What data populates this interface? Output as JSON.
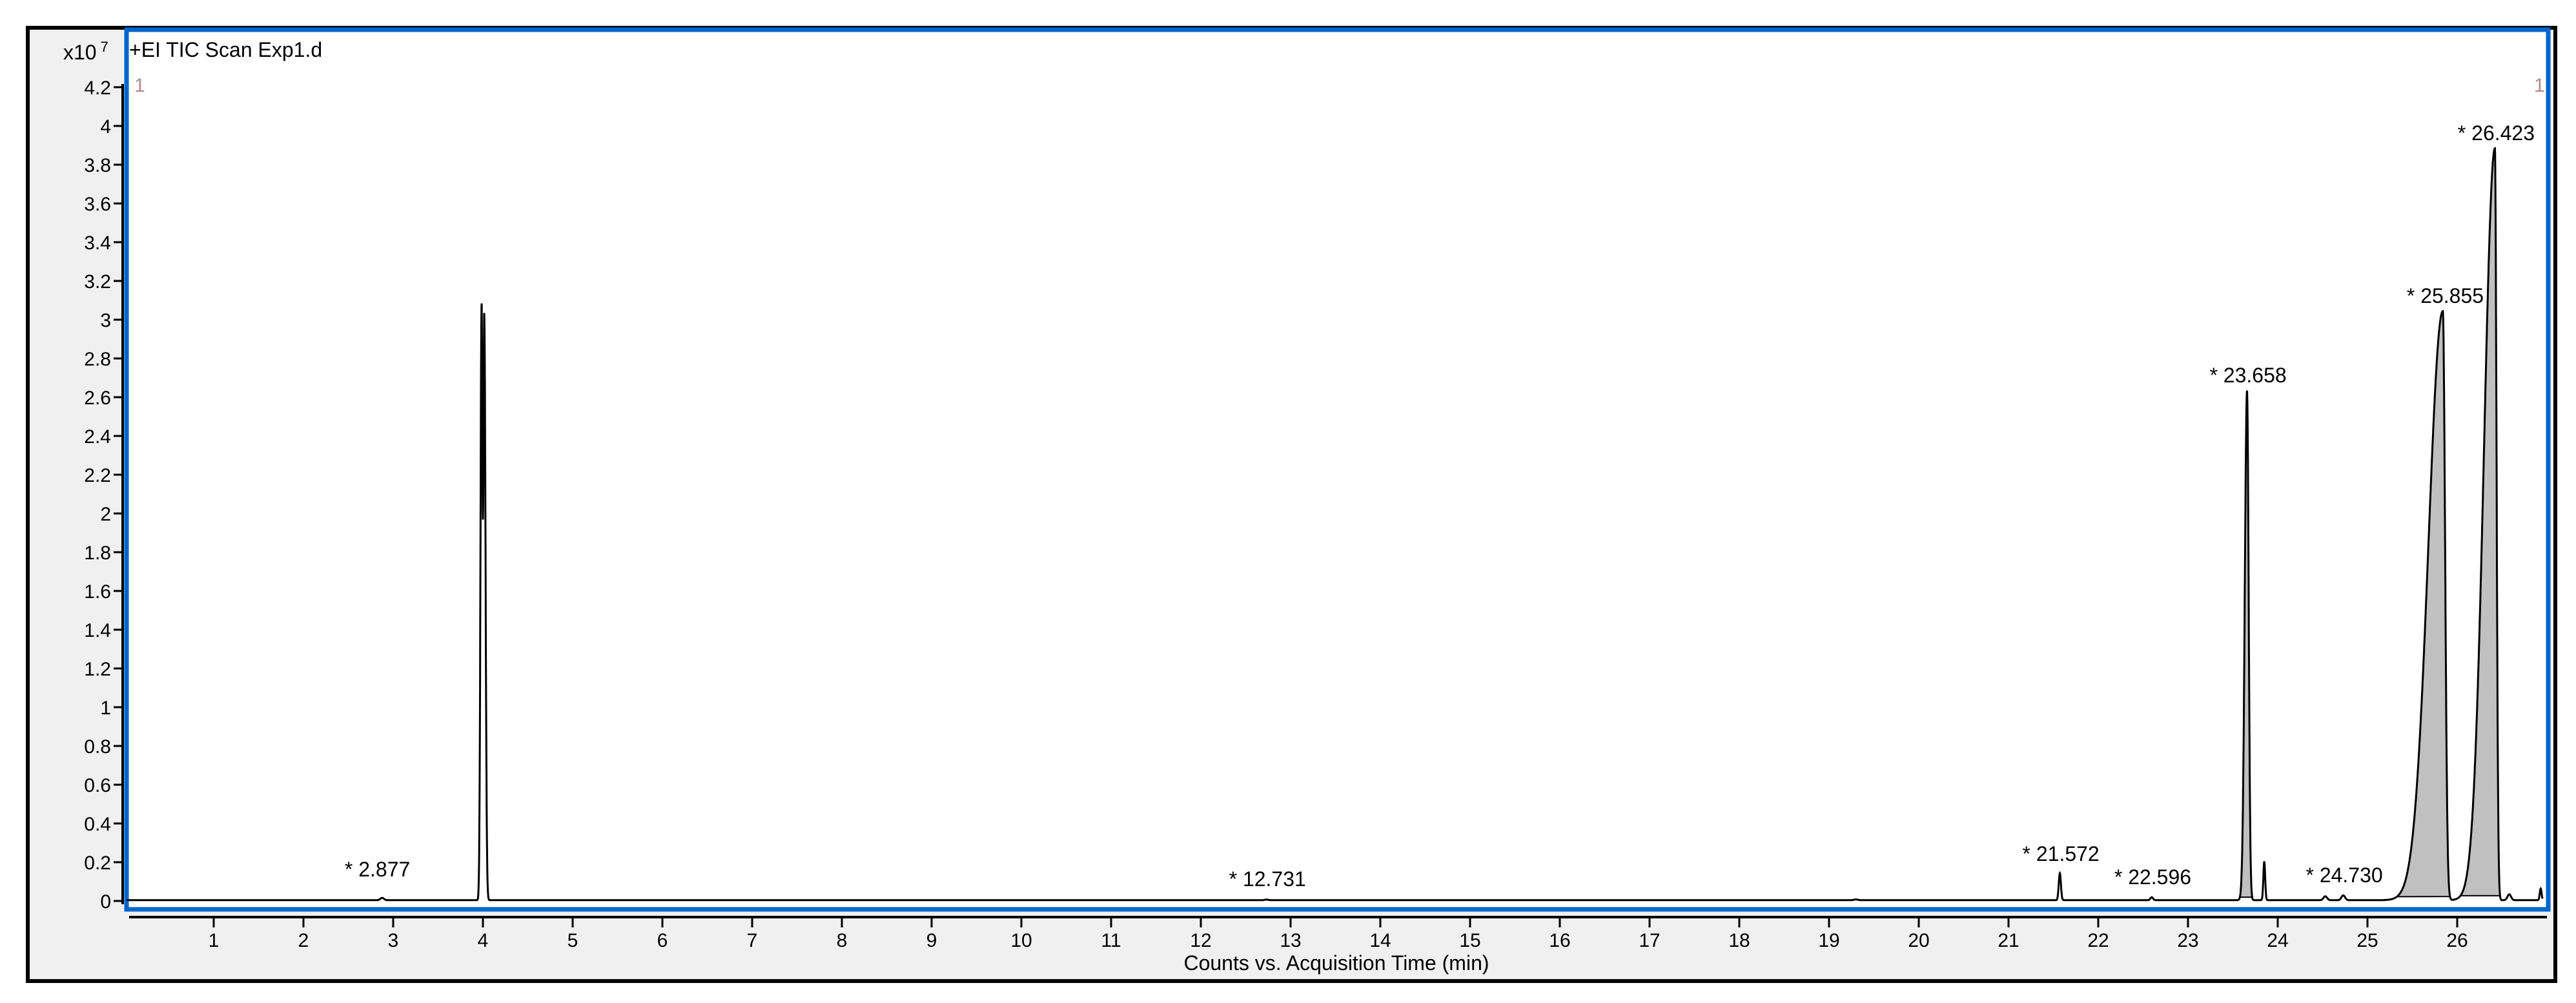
{
  "chart_data": {
    "type": "line",
    "title": "+EI TIC Scan Exp1.d",
    "y_multiplier": "x10",
    "y_multiplier_exp": "7",
    "xlabel": "Counts vs. Acquisition Time (min)",
    "ylabel": "",
    "xlim": [
      0,
      26.9
    ],
    "ylim": [
      0,
      4.3
    ],
    "x_ticks": [
      "1",
      "2",
      "3",
      "4",
      "5",
      "6",
      "7",
      "8",
      "9",
      "10",
      "11",
      "12",
      "13",
      "14",
      "15",
      "16",
      "17",
      "18",
      "19",
      "20",
      "21",
      "22",
      "23",
      "24",
      "25",
      "26"
    ],
    "y_ticks": [
      "0",
      "0.2",
      "0.4",
      "0.6",
      "0.8",
      "1",
      "1.2",
      "1.4",
      "1.6",
      "1.8",
      "2",
      "2.2",
      "2.4",
      "2.6",
      "2.8",
      "3",
      "3.2",
      "3.4",
      "3.6",
      "3.8",
      "4",
      "4.2"
    ],
    "corner_labels": {
      "left": "1",
      "right": "1"
    },
    "grid": false,
    "baseline": 0.004,
    "peaks": [
      {
        "rt": 2.877,
        "height": 0.012,
        "sl": 0.02,
        "sr": 0.02,
        "filled": false
      },
      {
        "rt": 3.985,
        "height": 3.05,
        "sl": 0.012,
        "sr": 0.01,
        "filled": false
      },
      {
        "rt": 4.015,
        "height": 3.0,
        "sl": 0.01,
        "sr": 0.014,
        "filled": false
      },
      {
        "rt": 12.731,
        "height": 0.003,
        "sl": 0.02,
        "sr": 0.02,
        "filled": false
      },
      {
        "rt": 19.3,
        "height": 0.004,
        "sl": 0.02,
        "sr": 0.02,
        "filled": false
      },
      {
        "rt": 21.572,
        "height": 0.14,
        "sl": 0.012,
        "sr": 0.012,
        "filled": false
      },
      {
        "rt": 22.596,
        "height": 0.015,
        "sl": 0.015,
        "sr": 0.015,
        "filled": false
      },
      {
        "rt": 23.658,
        "height": 2.63,
        "sl": 0.025,
        "sr": 0.018,
        "filled": true
      },
      {
        "rt": 23.85,
        "height": 0.2,
        "sl": 0.01,
        "sr": 0.01,
        "filled": false
      },
      {
        "rt": 24.53,
        "height": 0.02,
        "sl": 0.02,
        "sr": 0.02,
        "filled": false
      },
      {
        "rt": 24.73,
        "height": 0.025,
        "sl": 0.02,
        "sr": 0.02,
        "filled": false
      },
      {
        "rt": 25.84,
        "height": 3.04,
        "sl": 0.16,
        "sr": 0.025,
        "filled": true
      },
      {
        "rt": 26.42,
        "height": 3.88,
        "sl": 0.12,
        "sr": 0.018,
        "filled": true
      },
      {
        "rt": 26.58,
        "height": 0.03,
        "sl": 0.02,
        "sr": 0.02,
        "filled": false
      },
      {
        "rt": 26.93,
        "height": 0.06,
        "sl": 0.01,
        "sr": 0.01,
        "filled": false
      }
    ],
    "annotations": [
      {
        "text": "* 2.877",
        "rt": 2.877,
        "height": 0.08
      },
      {
        "text": "* 12.731",
        "rt": 12.731,
        "height": 0.03
      },
      {
        "text": "* 21.572",
        "rt": 21.572,
        "height": 0.16
      },
      {
        "text": "* 22.596",
        "rt": 22.596,
        "height": 0.04
      },
      {
        "text": "* 23.658",
        "rt": 23.658,
        "height": 2.63
      },
      {
        "text": "* 24.730",
        "rt": 24.73,
        "height": 0.05
      },
      {
        "text": "* 25.855",
        "rt": 25.855,
        "height": 3.04
      },
      {
        "text": "* 26.423",
        "rt": 26.423,
        "height": 3.88
      }
    ]
  },
  "colors": {
    "frame": "#000000",
    "plot_border": "#0066cc",
    "panel_bg": "#f0f0f0",
    "fill": "#c0c0c0",
    "trace": "#000000"
  }
}
